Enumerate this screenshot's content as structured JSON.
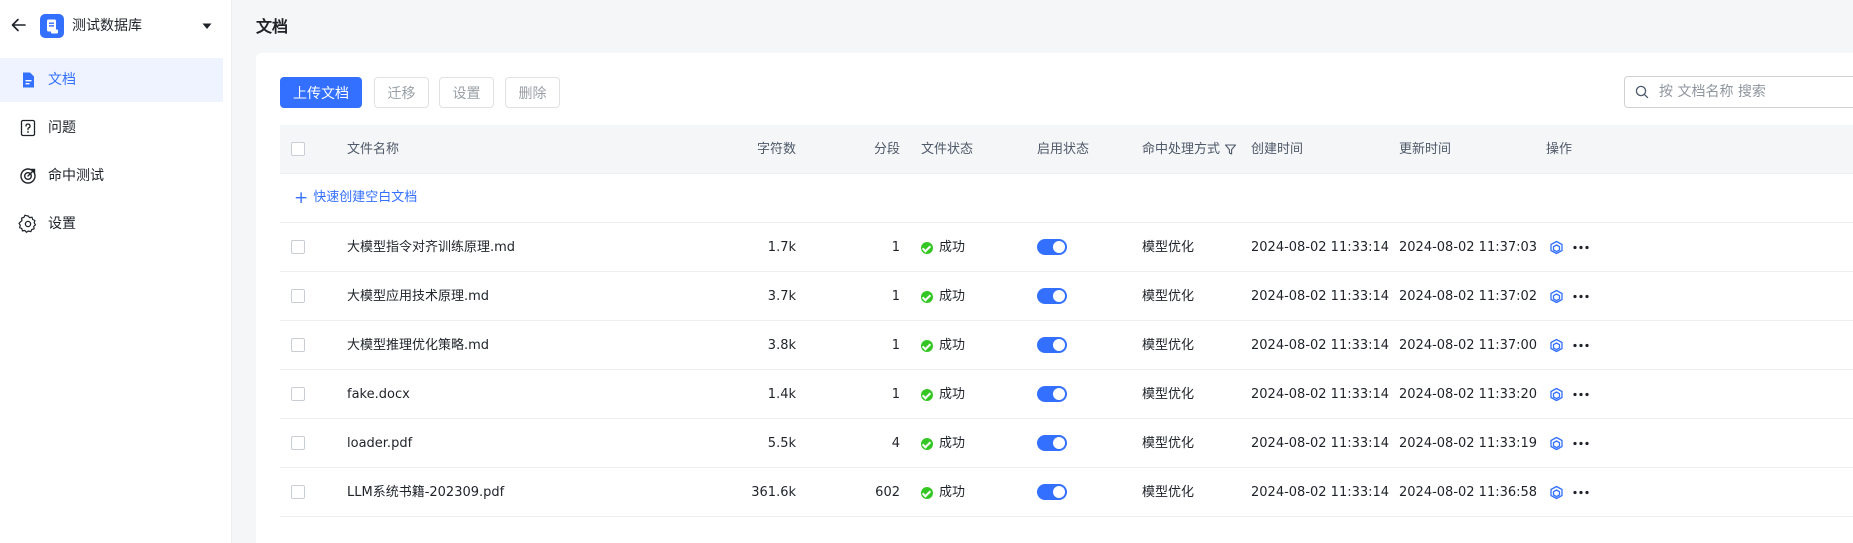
{
  "sidebar": {
    "db_name": "测试数据库",
    "nav": [
      {
        "label": "文档",
        "icon": "document-icon",
        "active": true
      },
      {
        "label": "问题",
        "icon": "question-icon",
        "active": false
      },
      {
        "label": "命中测试",
        "icon": "target-icon",
        "active": false
      },
      {
        "label": "设置",
        "icon": "gear-icon",
        "active": false
      }
    ]
  },
  "header": {
    "title": "文档"
  },
  "toolbar": {
    "upload": "上传文档",
    "migrate": "迁移",
    "settings": "设置",
    "delete": "删除",
    "search_placeholder": "按 文档名称 搜索"
  },
  "table": {
    "columns": {
      "name": "文件名称",
      "chars": "字符数",
      "segments": "分段",
      "file_status": "文件状态",
      "enable_status": "启用状态",
      "hit_method": "命中处理方式",
      "created": "创建时间",
      "updated": "更新时间",
      "actions": "操作"
    },
    "quick_create": "快速创建空白文档",
    "rows": [
      {
        "name": "大模型指令对齐训练原理.md",
        "chars": "1.7k",
        "segments": "1",
        "status": "成功",
        "enabled": true,
        "hit": "模型优化",
        "created": "2024-08-02 11:33:14",
        "updated": "2024-08-02 11:37:03"
      },
      {
        "name": "大模型应用技术原理.md",
        "chars": "3.7k",
        "segments": "1",
        "status": "成功",
        "enabled": true,
        "hit": "模型优化",
        "created": "2024-08-02 11:33:14",
        "updated": "2024-08-02 11:37:02"
      },
      {
        "name": "大模型推理优化策略.md",
        "chars": "3.8k",
        "segments": "1",
        "status": "成功",
        "enabled": true,
        "hit": "模型优化",
        "created": "2024-08-02 11:33:14",
        "updated": "2024-08-02 11:37:00"
      },
      {
        "name": "fake.docx",
        "chars": "1.4k",
        "segments": "1",
        "status": "成功",
        "enabled": true,
        "hit": "模型优化",
        "created": "2024-08-02 11:33:14",
        "updated": "2024-08-02 11:33:20"
      },
      {
        "name": "loader.pdf",
        "chars": "5.5k",
        "segments": "4",
        "status": "成功",
        "enabled": true,
        "hit": "模型优化",
        "created": "2024-08-02 11:33:14",
        "updated": "2024-08-02 11:33:19"
      },
      {
        "name": "LLM系统书籍-202309.pdf",
        "chars": "361.6k",
        "segments": "602",
        "status": "成功",
        "enabled": true,
        "hit": "模型优化",
        "created": "2024-08-02 11:33:14",
        "updated": "2024-08-02 11:36:58"
      }
    ]
  },
  "colors": {
    "accent": "#3370ff",
    "success": "#34c724",
    "active_bg": "#eef3ff"
  }
}
